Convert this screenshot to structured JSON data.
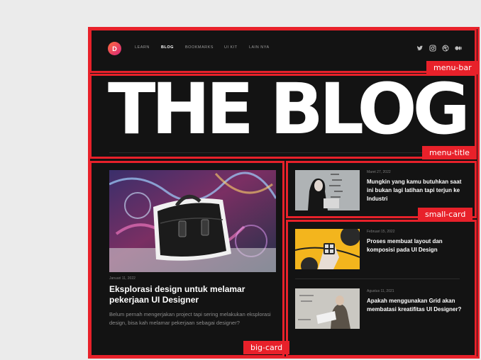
{
  "brand": {
    "logo_letter": "D"
  },
  "nav": {
    "items": [
      {
        "label": "LEARN",
        "active": false
      },
      {
        "label": "BLOG",
        "active": true
      },
      {
        "label": "BOOKMARKS",
        "active": false
      },
      {
        "label": "UI KIT",
        "active": false
      },
      {
        "label": "LAIN NYA",
        "active": false
      }
    ],
    "social_icons": [
      "twitter-icon",
      "instagram-icon",
      "dribbble-icon",
      "medium-icon"
    ]
  },
  "hero": {
    "title": "THE BLOG"
  },
  "annotations": {
    "menu_bar": "menu-bar",
    "menu_title": "menu-title",
    "big_card": "big-card",
    "small_card": "small-card"
  },
  "big_card": {
    "date": "Januari 11, 2022",
    "title": "Eksplorasi design untuk melamar pekerjaan UI Designer",
    "description": "Belum pernah mengerjakan project tapi sering melakukan eksplorasi design, bisa kah melamar pekerjaan sebagai designer?"
  },
  "small_cards": [
    {
      "date": "Maret 27, 2022",
      "title": "Mungkin yang kamu butuhkan saat ini bukan lagi latihan tapi terjun ke Industri"
    },
    {
      "date": "Februari 15, 2022",
      "title": "Proses membuat layout dan komposisi pada UI Design"
    },
    {
      "date": "Agustus 11, 2021",
      "title": "Apakah menggunakan Grid akan membatasi kreatifitas UI Designer?"
    }
  ],
  "colors": {
    "accent": "#e8212a",
    "background": "#131313",
    "canvas": "#ebebeb"
  }
}
